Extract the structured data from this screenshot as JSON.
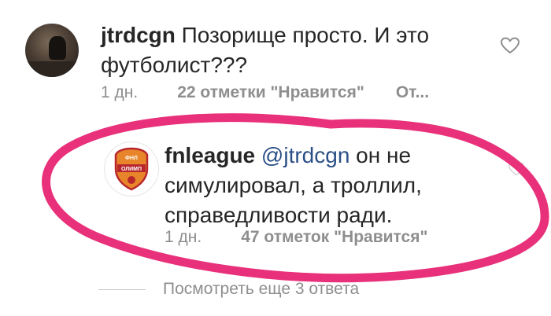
{
  "comment": {
    "username": "jtrdcgn",
    "text": "Позорище просто. И это футболист???",
    "line1_text": "Позорище просто. И это",
    "line2_text": "футболист???",
    "time": "1 дн.",
    "likes": "22 отметки \"Нравится\"",
    "reply": "От..."
  },
  "reply_comment": {
    "username": "fnleague",
    "mention": "@jtrdcgn",
    "line1_text": "он не",
    "line2_text": "симулировал, а троллил,",
    "line3_text": "справедливости ради.",
    "time": "1 дн.",
    "likes": "47 отметок \"Нравится\"",
    "avatar_logo": "ФНЛ ОЛИМП"
  },
  "view_more": "Посмотреть еще 3 ответа",
  "colors": {
    "text": "#262626",
    "meta": "#8e8e8e",
    "mention": "#2b4f86",
    "annotation": "#e8317a",
    "logo_orange": "#e8852a",
    "logo_red": "#b8262d"
  }
}
